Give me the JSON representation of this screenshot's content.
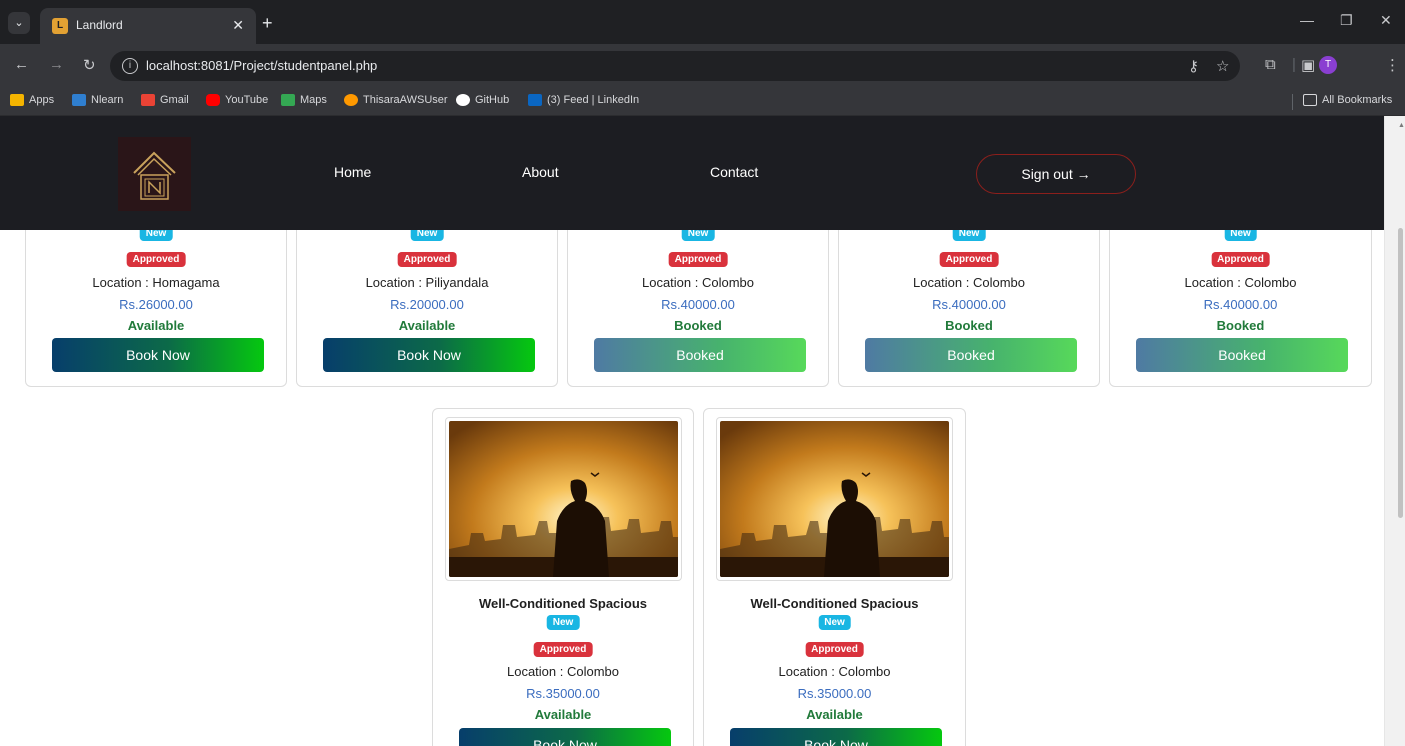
{
  "browser": {
    "tab_title": "Landlord",
    "tab_favicon_letter": "L",
    "url": "localhost:8081/Project/studentpanel.php",
    "profile_initial": "T",
    "bookmarks": [
      {
        "label": "Apps",
        "icon": "apps-grid-icon",
        "color": "#f4b400"
      },
      {
        "label": "Nlearn",
        "icon": "nlearn-icon",
        "color": "#2f7fd0"
      },
      {
        "label": "Gmail",
        "icon": "gmail-icon",
        "color": "#ea4335"
      },
      {
        "label": "YouTube",
        "icon": "youtube-icon",
        "color": "#ff0000"
      },
      {
        "label": "Maps",
        "icon": "maps-icon",
        "color": "#34a853"
      },
      {
        "label": "ThisaraAWSUser",
        "icon": "aws-icon",
        "color": "#ff9900"
      },
      {
        "label": "GitHub",
        "icon": "github-icon",
        "color": "#ffffff"
      },
      {
        "label": "(3) Feed | LinkedIn",
        "icon": "linkedin-icon",
        "color": "#0a66c2"
      }
    ],
    "all_bookmarks": "All Bookmarks"
  },
  "header": {
    "nav": [
      "Home",
      "About",
      "Contact"
    ],
    "signout": "Sign out →"
  },
  "listings_row1": [
    {
      "badge_new": "New",
      "badge_approved": "Approved",
      "location": "Location : Homagama",
      "price": "Rs.26000.00",
      "status": "Available",
      "button": "Book Now",
      "booked": false
    },
    {
      "badge_new": "New",
      "badge_approved": "Approved",
      "location": "Location : Piliyandala",
      "price": "Rs.20000.00",
      "status": "Available",
      "button": "Book Now",
      "booked": false
    },
    {
      "badge_new": "New",
      "badge_approved": "Approved",
      "location": "Location : Colombo",
      "price": "Rs.40000.00",
      "status": "Booked",
      "button": "Booked",
      "booked": true
    },
    {
      "badge_new": "New",
      "badge_approved": "Approved",
      "location": "Location : Colombo",
      "price": "Rs.40000.00",
      "status": "Booked",
      "button": "Booked",
      "booked": true
    },
    {
      "badge_new": "New",
      "badge_approved": "Approved",
      "location": "Location : Colombo",
      "price": "Rs.40000.00",
      "status": "Booked",
      "button": "Booked",
      "booked": true
    }
  ],
  "listings_row2": [
    {
      "title": "Well-Conditioned Spacious",
      "badge_new": "New",
      "badge_approved": "Approved",
      "location": "Location : Colombo",
      "price": "Rs.35000.00",
      "status": "Available",
      "button": "Book Now",
      "booked": false
    },
    {
      "title": "Well-Conditioned Spacious",
      "badge_new": "New",
      "badge_approved": "Approved",
      "location": "Location : Colombo",
      "price": "Rs.35000.00",
      "status": "Available",
      "button": "Book Now",
      "booked": false
    }
  ],
  "colors": {
    "header_bg": "#1c1d22",
    "badge_new": "#19b6e3",
    "badge_approved": "#d9323c",
    "price": "#3b6dbf",
    "status": "#217a3a",
    "signout_border": "#8b1f1c"
  }
}
